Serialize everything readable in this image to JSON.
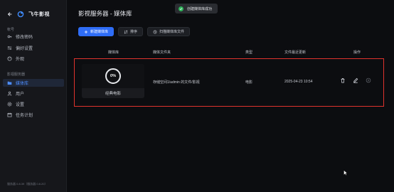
{
  "sidebar": {
    "brand_name": "飞牛影视",
    "sections": [
      {
        "title": "帐号"
      },
      {
        "title": "影视服务器"
      }
    ],
    "account_items": [
      {
        "label": "修改密码",
        "icon": "key-icon"
      },
      {
        "label": "偏好设置",
        "icon": "sliders-icon"
      },
      {
        "label": "外观",
        "icon": "palette-icon"
      }
    ],
    "server_items": [
      {
        "label": "媒体库",
        "icon": "folder-icon",
        "active": true
      },
      {
        "label": "用户",
        "icon": "user-icon"
      },
      {
        "label": "设置",
        "icon": "gear-icon"
      },
      {
        "label": "任务计划",
        "icon": "calendar-icon"
      }
    ],
    "version": "服务器 0.8.39（服务器 0.8.20）"
  },
  "header": {
    "title": "影视服务器 - 媒体库"
  },
  "toast": {
    "message": "创建媒体库成功"
  },
  "toolbar": {
    "new_label": "新建媒体库",
    "sort_label": "排序",
    "scan_label": "扫描媒体库文件"
  },
  "table": {
    "headers": [
      "媒体库",
      "媒体文件夹",
      "类型",
      "文件最近更新",
      "操作"
    ],
    "rows": [
      {
        "name": "经典电影",
        "progress": "0%",
        "folder": "存储空间1/admin 的文件/影视",
        "type": "电影",
        "updated": "2025-04-23 10:54"
      }
    ]
  },
  "colors": {
    "accent": "#2f6df6",
    "highlight": "#e0332d",
    "success": "#2fb35a"
  }
}
